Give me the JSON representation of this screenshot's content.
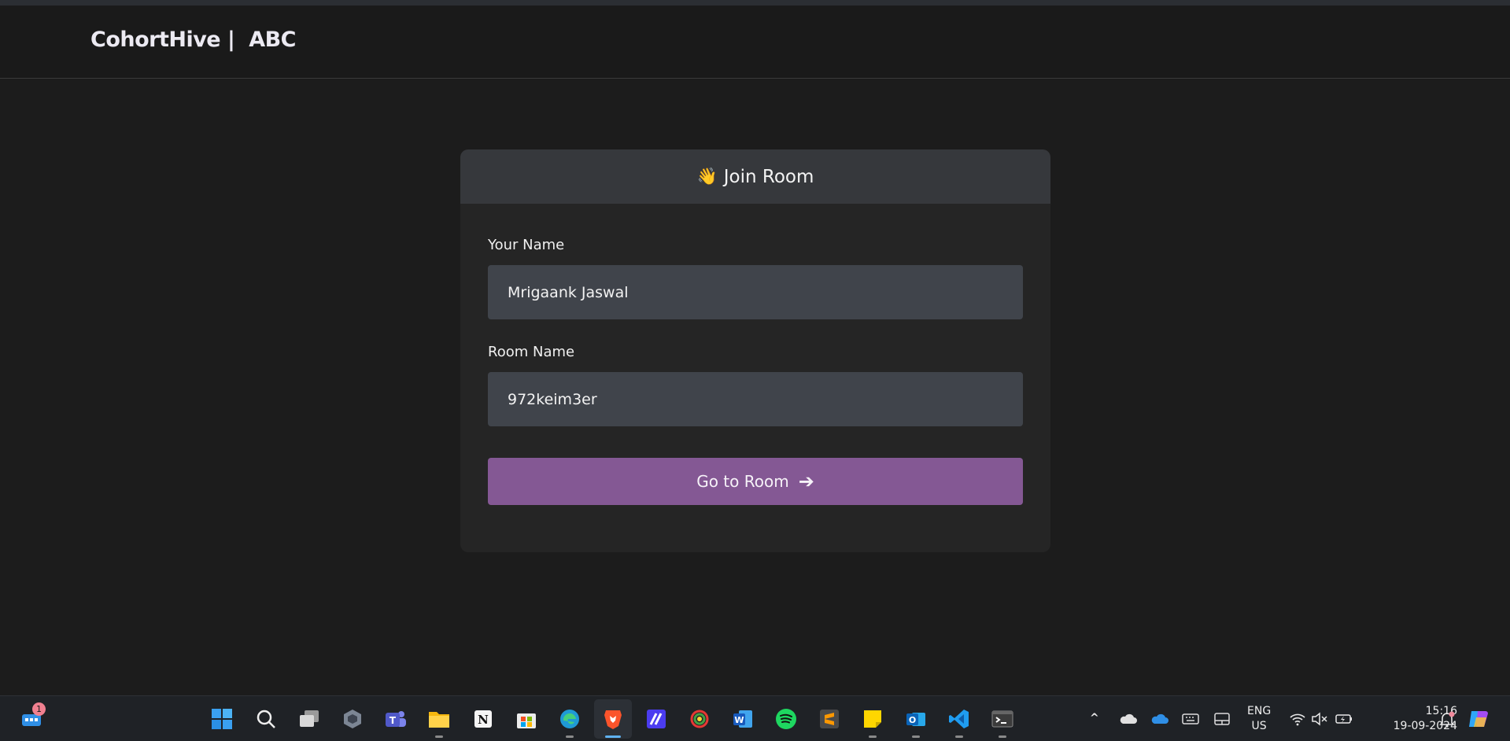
{
  "header": {
    "brand": "CohortHive |",
    "org": "ABC"
  },
  "card": {
    "wave": "👋",
    "title": "Join Room",
    "name_label": "Your Name",
    "name_value": "Mrigaank Jaswal",
    "room_label": "Room Name",
    "room_value": "972keim3er",
    "button_label": "Go to Room",
    "button_arrow": "➔",
    "accent_color": "#845894"
  },
  "taskbar": {
    "widgets_badge": "1",
    "apps": [
      "start",
      "search",
      "task-view",
      "app-4",
      "teams",
      "file-explorer",
      "notion",
      "store",
      "edge",
      "brave",
      "app-11",
      "app-12",
      "word",
      "spotify",
      "sublime-text",
      "sticky-notes",
      "outlook",
      "vs-code",
      "terminal"
    ],
    "tray_chevron": "^",
    "language": "ENG",
    "region": "US",
    "time": "15:16",
    "date": "19-09-2024"
  }
}
